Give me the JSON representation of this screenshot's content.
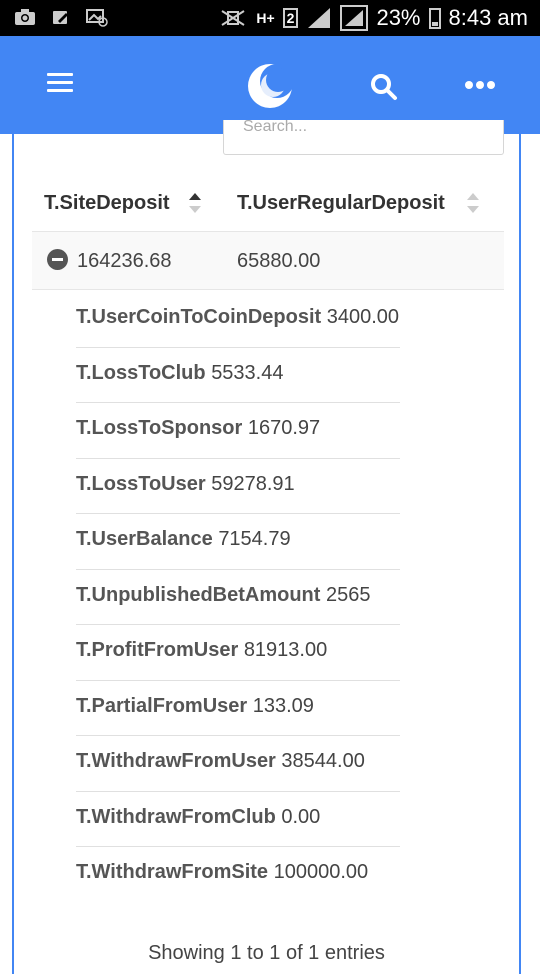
{
  "status_bar": {
    "network": "H+",
    "sim": "2",
    "battery": "23%",
    "time": "8:43 am"
  },
  "app_bar": {
    "icons": [
      "menu-icon",
      "app-logo",
      "search-icon",
      "more-horizontal-icon"
    ]
  },
  "search": {
    "placeholder": "Search..."
  },
  "table": {
    "columns": [
      "T.SiteDeposit",
      "T.UserRegularDeposit"
    ],
    "row": {
      "site_deposit": "164236.68",
      "user_regular_deposit": "65880.00"
    },
    "details": [
      {
        "label": "T.UserCoinToCoinDeposit",
        "value": "3400.00"
      },
      {
        "label": "T.LossToClub",
        "value": "5533.44"
      },
      {
        "label": "T.LossToSponsor",
        "value": "1670.97"
      },
      {
        "label": "T.LossToUser",
        "value": "59278.91"
      },
      {
        "label": "T.UserBalance",
        "value": "7154.79"
      },
      {
        "label": "T.UnpublishedBetAmount",
        "value": "2565"
      },
      {
        "label": "T.ProfitFromUser",
        "value": "81913.00"
      },
      {
        "label": "T.PartialFromUser",
        "value": "133.09"
      },
      {
        "label": "T.WithdrawFromUser",
        "value": "38544.00"
      },
      {
        "label": "T.WithdrawFromClub",
        "value": "0.00"
      },
      {
        "label": "T.WithdrawFromSite",
        "value": "100000.00"
      }
    ]
  },
  "footer": {
    "info": "Showing 1 to 1 of 1 entries"
  },
  "colors": {
    "primary": "#4286f4",
    "status_bar": "#000000"
  }
}
